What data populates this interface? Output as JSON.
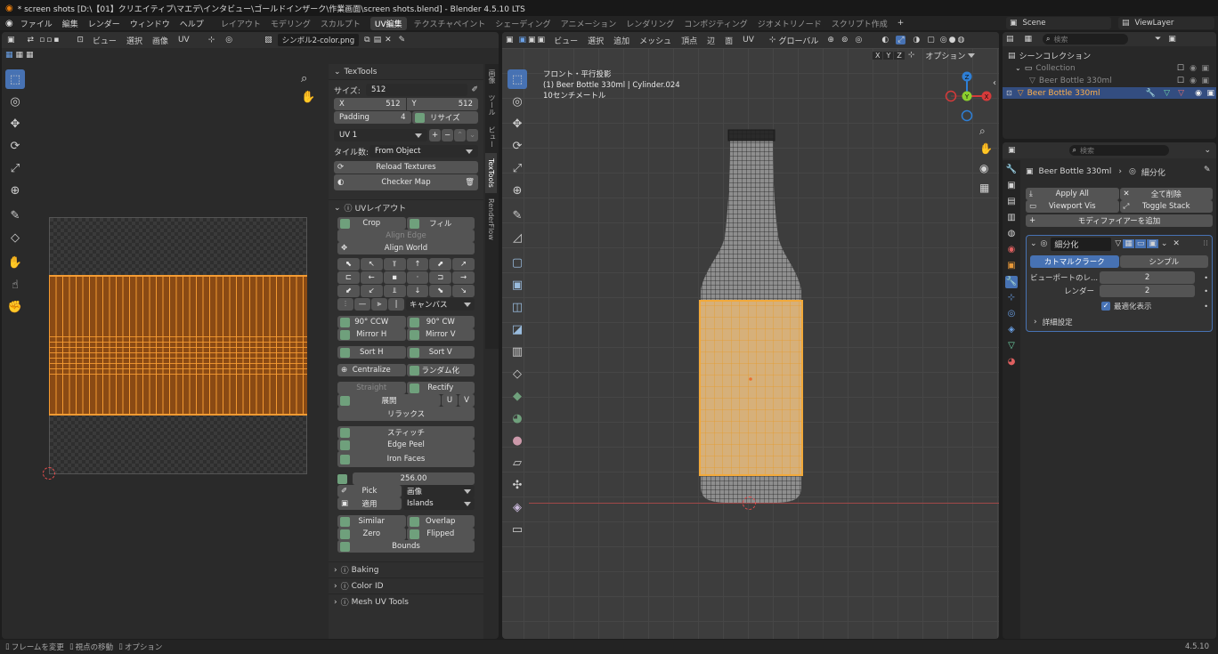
{
  "window": {
    "title": "* screen shots [D:\\【01】クリエイティブ\\マエデ\\インタビュー\\ゴールドインザーク\\作業画面\\screen shots.blend] - Blender 4.5.10 LTS"
  },
  "menu": {
    "items": [
      "ファイル",
      "編集",
      "レンダー",
      "ウィンドウ",
      "ヘルプ"
    ]
  },
  "workspaces": {
    "items": [
      "レイアウト",
      "モデリング",
      "スカルプト",
      "UV編集",
      "テクスチャペイント",
      "シェーディング",
      "アニメーション",
      "レンダリング",
      "コンポジティング",
      "ジオメトリノード",
      "スクリプト作成"
    ],
    "active": "UV編集",
    "add": "+"
  },
  "scene": {
    "label": "Scene",
    "viewlayer": "ViewLayer"
  },
  "uv_editor": {
    "menus": [
      "ビュー",
      "選択",
      "画像",
      "UV"
    ],
    "image_name": "シンボル2-color.png"
  },
  "sidebar_tabs": [
    "画像",
    "ツール",
    "ビュー",
    "TexTools",
    "RenderFlow"
  ],
  "textools": {
    "title": "TexTools",
    "size_label": "サイズ:",
    "size_value": "512",
    "x_label": "X",
    "x_value": "512",
    "y_label": "Y",
    "y_value": "512",
    "padding_label": "Padding",
    "padding_value": "4",
    "resize_label": "リサイズ",
    "uv_channel": "UV 1",
    "tile_label": "タイル数:",
    "tile_value": "From Object",
    "reload": "Reload Textures",
    "checker": "Checker Map"
  },
  "uv_layout": {
    "title": "UVレイアウト",
    "crop": "Crop",
    "fill": "フィル",
    "align_edge": "Align Edge",
    "align_world": "Align World",
    "canvas": "キャンバス",
    "rot_ccw": "90° CCW",
    "rot_cw": "90° CW",
    "mirror_h": "Mirror H",
    "mirror_v": "Mirror V",
    "sort_h": "Sort H",
    "sort_v": "Sort V",
    "centralize": "Centralize",
    "randomize": "ランダム化",
    "straight": "Straight",
    "rectify": "Rectify",
    "unfold": "展開",
    "u": "U",
    "v": "V",
    "relax": "リラックス",
    "stitch": "スティッチ",
    "edge_peel": "Edge Peel",
    "iron_faces": "Iron Faces",
    "texel_value": "256.00",
    "pick": "Pick",
    "pick_dropdown": "画像",
    "apply": "適用",
    "apply_dropdown": "Islands",
    "similar": "Similar",
    "overlap": "Overlap",
    "zero": "Zero",
    "flipped": "Flipped",
    "bounds": "Bounds"
  },
  "panels": {
    "baking": "Baking",
    "color_id": "Color ID",
    "mesh_uv_tools": "Mesh UV Tools"
  },
  "viewport": {
    "menus": [
      "ビュー",
      "選択",
      "追加",
      "メッシュ",
      "頂点",
      "辺",
      "面",
      "UV"
    ],
    "orientation": "グローバル",
    "axis_buttons": [
      "X",
      "Y",
      "Z"
    ],
    "options": "オプション",
    "view_name": "フロント・平行投影",
    "object_line": "(1) Beer Bottle 330ml | Cylinder.024",
    "scale_text": "10センチメートル",
    "gizmo": {
      "x": "X",
      "y": "Y",
      "z": "Z"
    }
  },
  "outliner": {
    "search_placeholder": "検索",
    "scene_collection": "シーンコレクション",
    "collection": "Collection",
    "item1": "Beer Bottle 330ml",
    "item2": "Beer Bottle 330ml"
  },
  "properties": {
    "search_placeholder": "検索",
    "object_name": "Beer Bottle 330ml",
    "modifier_crumb": "細分化",
    "apply_all": "Apply All",
    "delete_all": "全て削除",
    "viewport_vis": "Viewport Vis",
    "toggle_stack": "Toggle Stack",
    "add_modifier": "モディファイアーを追加",
    "modifier_name": "細分化",
    "tab_catmull": "カトマルクラーク",
    "tab_simple": "シンプル",
    "viewport_levels_label": "ビューポートのレ...",
    "viewport_levels": "2",
    "render_label": "レンダー",
    "render_levels": "2",
    "optimal_label": "最適化表示",
    "advanced": "詳細設定"
  },
  "statusbar": {
    "left": [
      "フレームを変更",
      "視点の移動",
      "オプション"
    ],
    "version": "4.5.10"
  },
  "colors": {
    "accent": "#4772b3",
    "uv_orange": "#e58a2a",
    "selected_row": "#334d80",
    "active_tab_bg": "#4772b3"
  }
}
